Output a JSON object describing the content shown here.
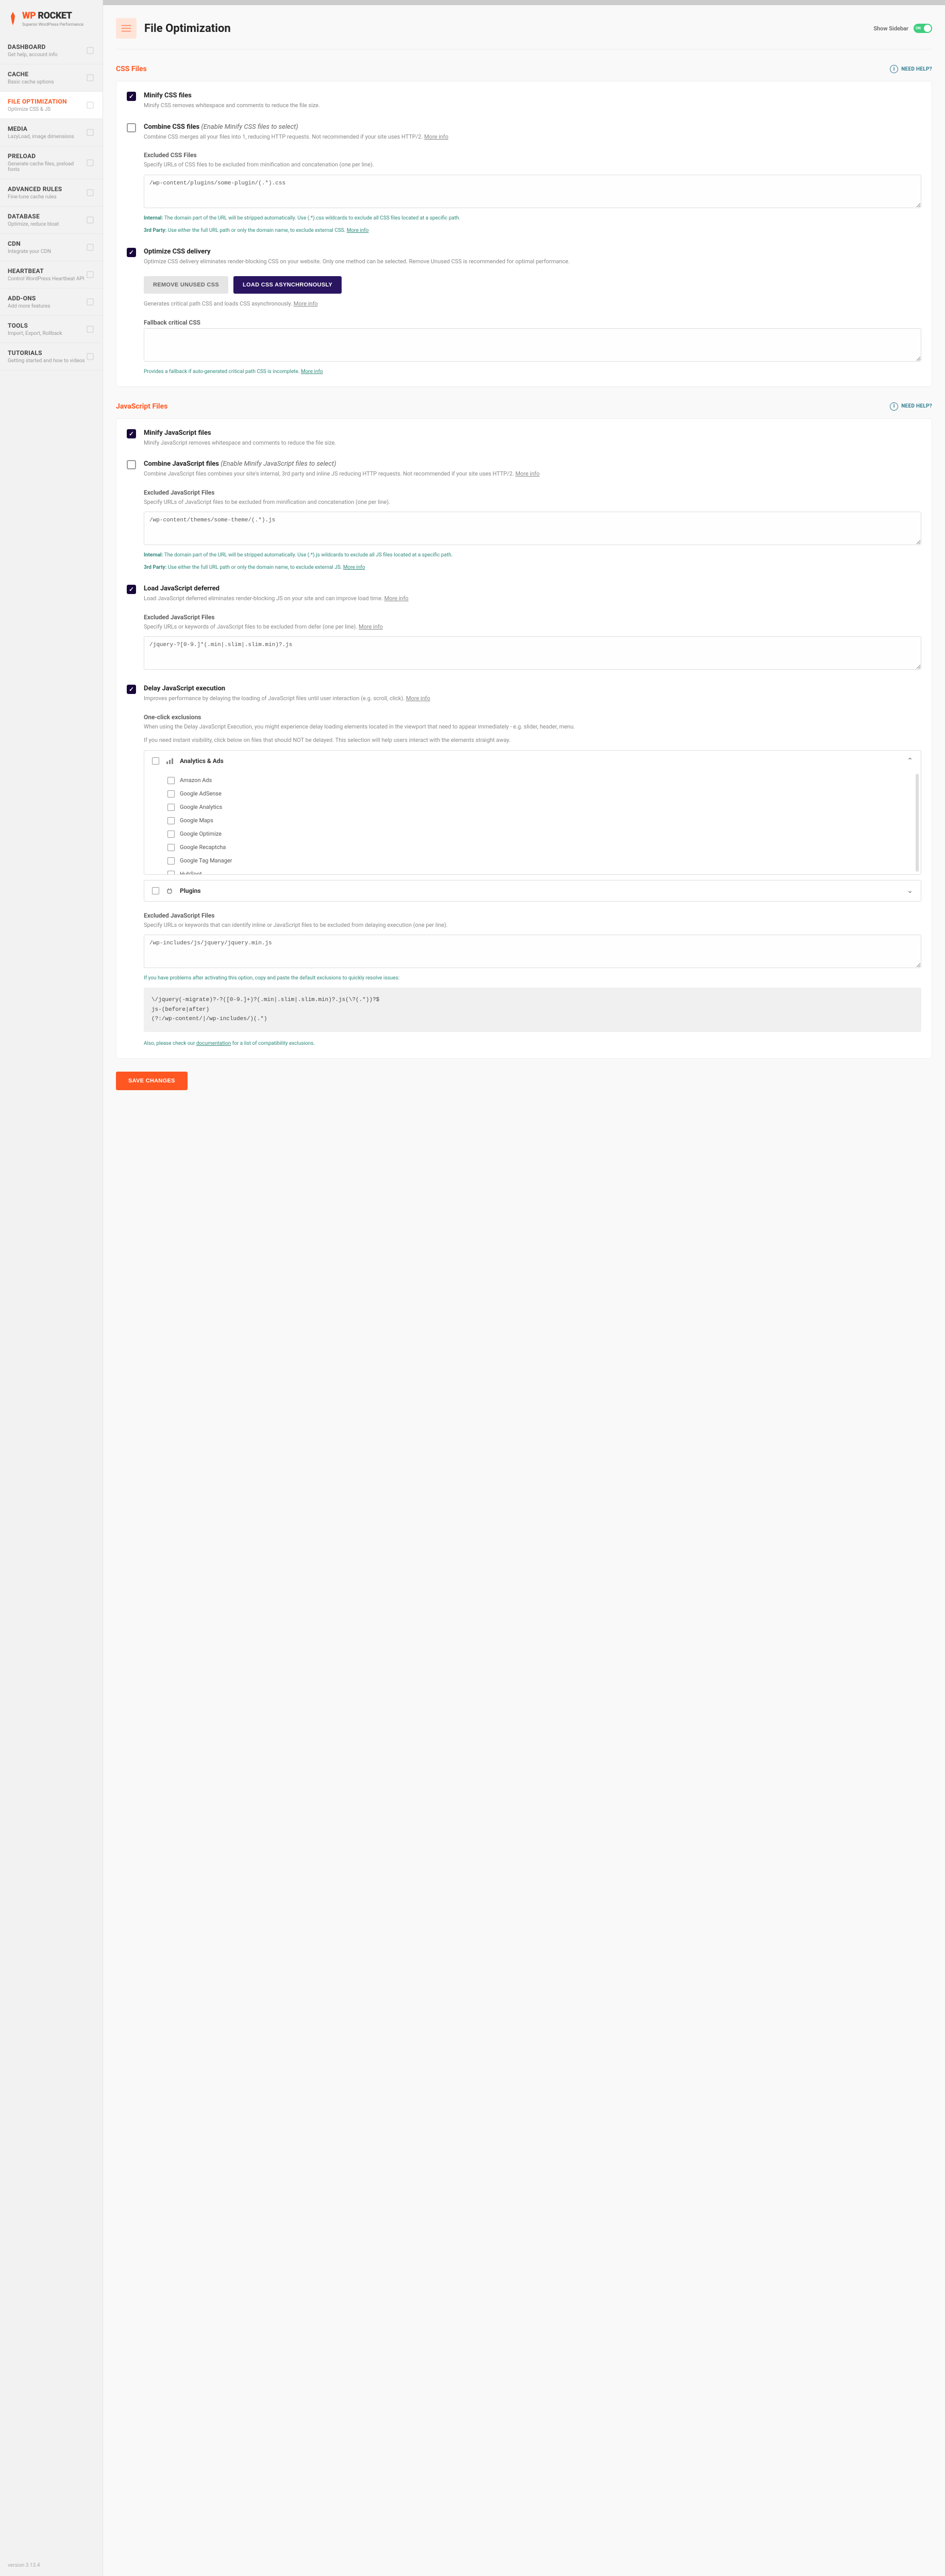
{
  "logo": {
    "wp": "WP",
    "rocket": "ROCKET",
    "sub": "Superior WordPress Performance"
  },
  "nav": [
    {
      "title": "DASHBOARD",
      "desc": "Get help, account info"
    },
    {
      "title": "CACHE",
      "desc": "Basic cache options"
    },
    {
      "title": "FILE OPTIMIZATION",
      "desc": "Optimize CSS & JS",
      "active": true
    },
    {
      "title": "MEDIA",
      "desc": "LazyLoad, image dimensions"
    },
    {
      "title": "PRELOAD",
      "desc": "Generate cache files, preload fonts"
    },
    {
      "title": "ADVANCED RULES",
      "desc": "Fine-tune cache rules"
    },
    {
      "title": "DATABASE",
      "desc": "Optimize, reduce bloat"
    },
    {
      "title": "CDN",
      "desc": "Integrate your CDN"
    },
    {
      "title": "HEARTBEAT",
      "desc": "Control WordPress Heartbeat API"
    },
    {
      "title": "ADD-ONS",
      "desc": "Add more features"
    },
    {
      "title": "TOOLS",
      "desc": "Import, Export, Rollback"
    },
    {
      "title": "TUTORIALS",
      "desc": "Getting started and how to videos"
    }
  ],
  "version": "version 3.13.4",
  "page": {
    "title": "File Optimization",
    "show_sidebar": "Show Sidebar",
    "toggle_on": "ON"
  },
  "help": "NEED HELP?",
  "more_info": "More info",
  "css": {
    "section": "CSS Files",
    "minify": {
      "title": "Minify CSS files",
      "desc": "Minify CSS removes whitespace and comments to reduce the file size."
    },
    "combine": {
      "title": "Combine CSS files",
      "hint": "(Enable Minify CSS files to select)",
      "desc": "Combine CSS merges all your files into 1, reducing HTTP requests. Not recommended if your site uses HTTP/2. ",
      "excluded_title": "Excluded CSS Files",
      "excluded_desc": "Specify URLs of CSS files to be excluded from minification and concatenation (one per line).",
      "excluded_value": "/wp-content/plugins/some-plugin/(.*).css",
      "note_internal_label": "Internal:",
      "note_internal": " The domain part of the URL will be stripped automatically. Use (.*).css wildcards to exclude all CSS files located at a specific path.",
      "note_3rd_label": "3rd Party:",
      "note_3rd": " Use either the full URL path or only the domain name, to exclude external CSS. "
    },
    "optimize": {
      "title": "Optimize CSS delivery",
      "desc": "Optimize CSS delivery eliminates render-blocking CSS on your website. Only one method can be selected. Remove Unused CSS is recommended for optimal performance.",
      "btn_remove": "REMOVE UNUSED CSS",
      "btn_load": "LOAD CSS ASYNCHRONOUSLY",
      "generates": "Generates critical path CSS and loads CSS asynchronously. ",
      "fallback_title": "Fallback critical CSS",
      "fallback_note": "Provides a fallback if auto-generated critical path CSS is incomplete. "
    }
  },
  "js": {
    "section": "JavaScript Files",
    "minify": {
      "title": "Minify JavaScript files",
      "desc": "Minify JavaScript removes whitespace and comments to reduce the file size."
    },
    "combine": {
      "title": "Combine JavaScript files",
      "hint": "(Enable Minify JavaScript files to select)",
      "desc": "Combine JavaScript files combines your site's internal, 3rd party and inline JS reducing HTTP requests. Not recommended if your site uses HTTP/2. ",
      "excluded_title": "Excluded JavaScript Files",
      "excluded_desc": "Specify URLs of JavaScript files to be excluded from minification and concatenation (one per line).",
      "excluded_value": "/wp-content/themes/some-theme/(.*).js",
      "note_internal_label": "Internal:",
      "note_internal": " The domain part of the URL will be stripped automatically. Use (.*).js wildcards to exclude all JS files located at a specific path.",
      "note_3rd_label": "3rd Party:",
      "note_3rd": " Use either the full URL path or only the domain name, to exclude external JS. "
    },
    "defer": {
      "title": "Load JavaScript deferred",
      "desc": "Load JavaScript deferred eliminates render-blocking JS on your site and can improve load time. ",
      "excluded_title": "Excluded JavaScript Files",
      "excluded_desc": "Specify URLs or keywords of JavaScript files to be excluded from defer (one per line). ",
      "excluded_value": "/jquery-?[0-9.]*(.min|.slim|.slim.min)?.js"
    },
    "delay": {
      "title": "Delay JavaScript execution",
      "desc": "Improves performance by delaying the loading of JavaScript files until user interaction (e.g. scroll, click). ",
      "oneclick_title": "One-click exclusions",
      "oneclick_p1": "When using the Delay JavaScript Execution, you might experience delay loading elements located in the viewport that need to appear immediately - e.g. slider, header, menu.",
      "oneclick_p2": "If you need instant visibility, click below on files that should NOT be delayed. This selection will help users interact with the elements straight away.",
      "group_analytics": "Analytics & Ads",
      "analytics_items": [
        "Amazon Ads",
        "Google AdSense",
        "Google Analytics",
        "Google Maps",
        "Google Optimize",
        "Google Recaptcha",
        "Google Tag Manager",
        "HubSpot"
      ],
      "group_plugins": "Plugins",
      "excluded_title": "Excluded JavaScript Files",
      "excluded_desc": "Specify URLs or keywords that can identify inline or JavaScript files to be excluded from delaying execution (one per line).",
      "excluded_value": "/wp-includes/js/jquery/jquery.min.js",
      "problems_note": "If you have problems after activating this option, copy and paste the default exclusions to quickly resolve issues:",
      "code": "\\/jquery(-migrate)?-?([0-9.]+)?(.min|.slim|.slim.min)?.js(\\?(.*))?$\njs-(before|after)\n(?:/wp-content/|/wp-includes/)(.*)",
      "doc_note_pre": "Also, please check our ",
      "doc_link": "documentation",
      "doc_note_post": " for a list of compatibility exclusions."
    }
  },
  "save": "SAVE CHANGES"
}
